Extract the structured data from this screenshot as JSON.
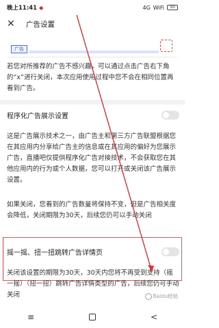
{
  "status_bar": {
    "time": "晚上11:41",
    "network": "4G",
    "wifi": "WiFi",
    "battery": "50"
  },
  "header": {
    "title": "广告设置"
  },
  "banner": {
    "ad_tag": "广告"
  },
  "intro_text": "若您对所推荐的广告不感兴趣，可以通过点击广告右下角的“x”进行关闭，本次应用使用过程中您不会在相同位置再看到广告。",
  "programmatic": {
    "label": "程序化广告展示设置",
    "enabled": false
  },
  "programmatic_desc": "这是广告展示技术之一，由广告主和第三方广告联盟根据您在其应用内分享给广告主的信息或在其应用的偏好为您展示广告，直播吧仅提供程序化广告对接技术，不会获取您在其他应用内的行为或个人数据，您可以打开或关闭该广告展示设置。",
  "programmatic_note": "如果关闭，您看到的广告数量将保持不变，但是广告相关度会降低，关闭期限为30天，后续您仍可以手动关闭",
  "shake": {
    "label": "摇一摇、扭一扭跳转广告详情页",
    "enabled": false
  },
  "shake_desc": "关闭该设置的期限为30天，30天内您将不再受到支持（摇一摇）（扭一扭）跳转广告详情类型的广告，后续您仍可手动关闭",
  "watermark": "Baidu经验",
  "nav": {
    "menu": "≡",
    "back": "<"
  }
}
